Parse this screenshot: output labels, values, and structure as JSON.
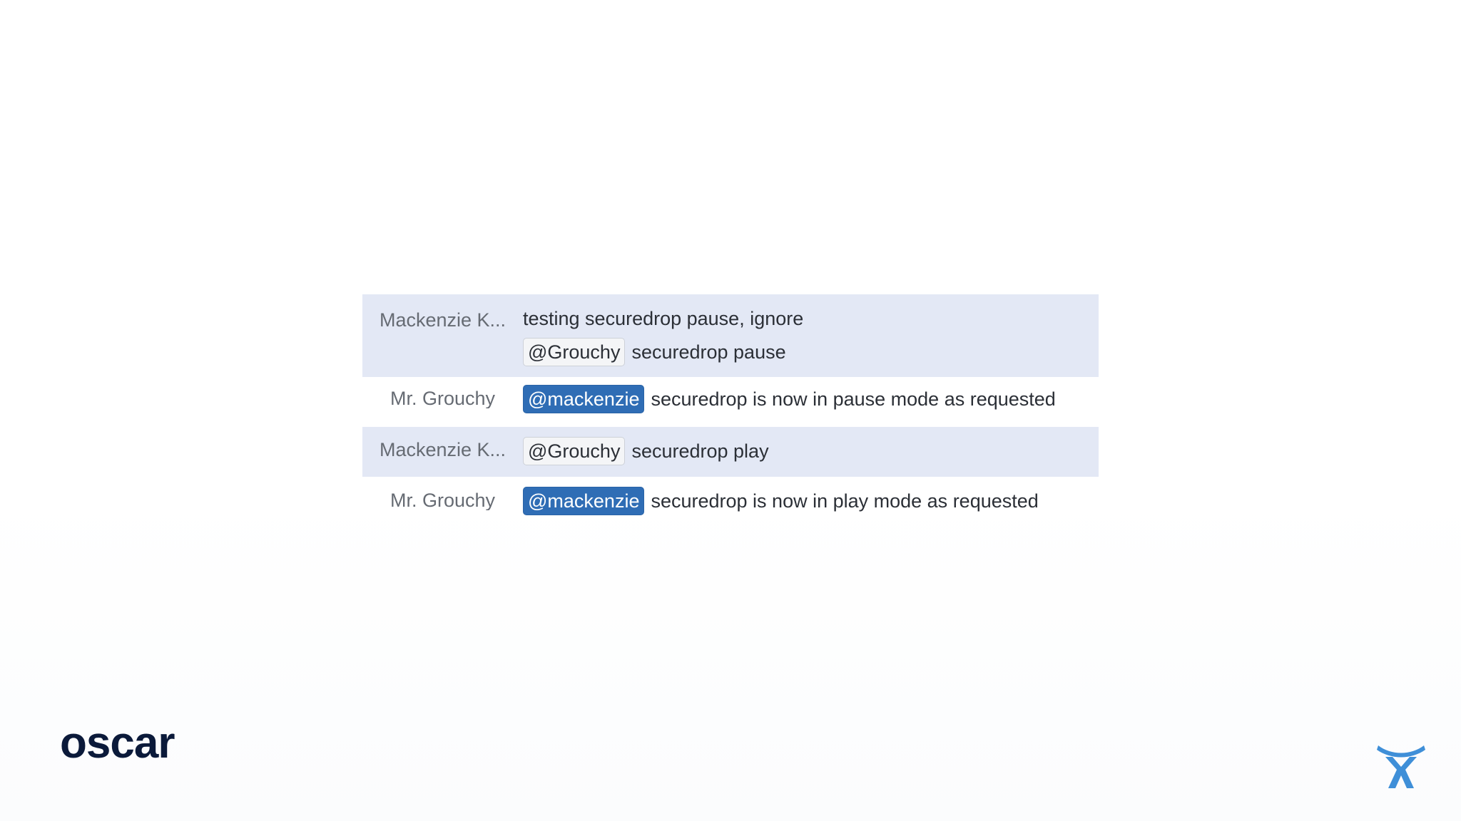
{
  "messages": [
    {
      "sender": "Mackenzie K...",
      "lines": [
        {
          "mention": "",
          "text": "testing securedrop pause, ignore"
        },
        {
          "mention": "@Grouchy",
          "text": "securedrop pause"
        }
      ]
    },
    {
      "sender": "Mr. Grouchy",
      "mention": "@mackenzie",
      "text": "securedrop is now in pause mode as requested"
    },
    {
      "sender": "Mackenzie K...",
      "mention": "@Grouchy",
      "text": "securedrop play"
    },
    {
      "sender": "Mr. Grouchy",
      "mention": "@mackenzie",
      "text": "securedrop is now in play mode as requested"
    }
  ],
  "branding": {
    "logo_text": "oscar",
    "corner_icon": "atlassian-logo-icon"
  },
  "colors": {
    "row_highlight": "#e3e8f5",
    "mention_blue": "#2f6db5",
    "mention_light": "#f4f5f7",
    "logo_navy": "#0b1a3a",
    "corner_icon_blue": "#3f8fd8"
  }
}
